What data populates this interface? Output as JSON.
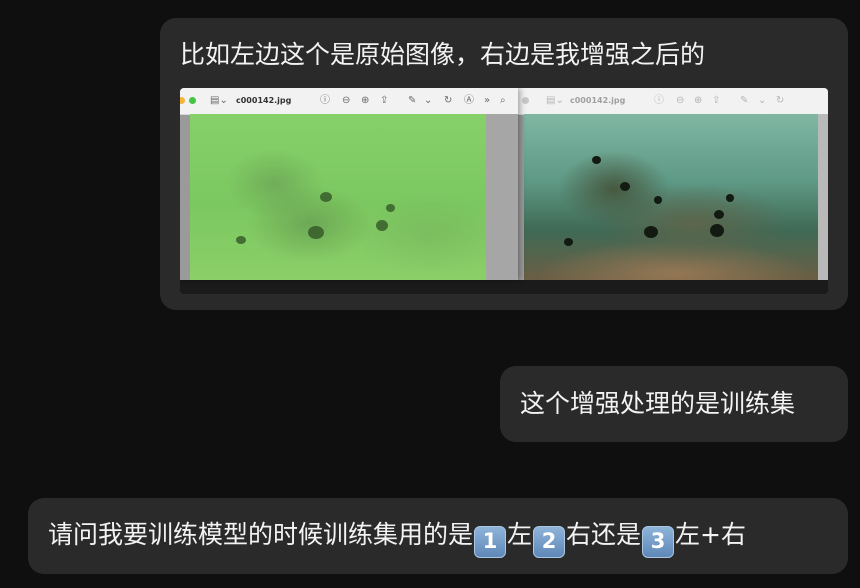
{
  "messages": [
    {
      "text": "比如左边这个是原始图像，右边是我增强之后的"
    },
    {
      "text": "这个增强处理的是训练集"
    },
    {
      "parts": [
        "请问我要训练模型的时候训练集用的是",
        "左",
        "右还是",
        "左+右"
      ],
      "keys": [
        "1",
        "2",
        "3"
      ]
    }
  ],
  "screenshot": {
    "left_viewer": {
      "filename": "c000142.jpg",
      "label": "original"
    },
    "right_viewer": {
      "filename": "c000142.jpg",
      "label": "enhanced"
    }
  },
  "colors": {
    "background": "#0f0f0f",
    "bubble": "#2a2a2a",
    "text": "#f3f3f3",
    "keycap": "#6f97c6"
  }
}
